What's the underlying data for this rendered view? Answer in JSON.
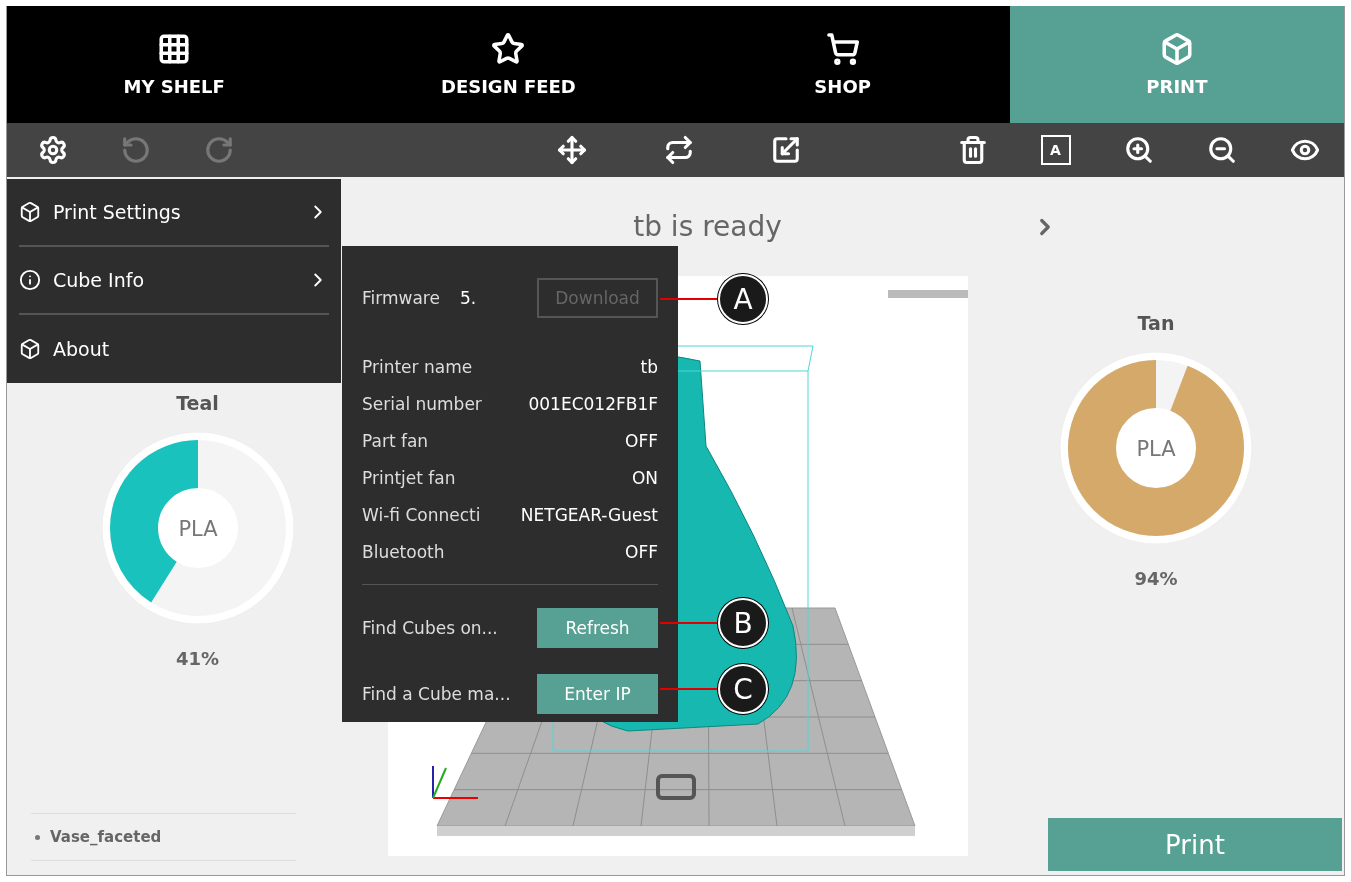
{
  "nav_tabs": [
    {
      "label": "MY SHELF",
      "selected": false
    },
    {
      "label": "DESIGN FEED",
      "selected": false
    },
    {
      "label": "SHOP",
      "selected": false
    },
    {
      "label": "PRINT",
      "selected": true
    }
  ],
  "toolbar": [
    {
      "disabled": false
    },
    {
      "disabled": true
    },
    {
      "disabled": true
    },
    {
      "disabled": false
    },
    {
      "disabled": false
    },
    {
      "disabled": false
    },
    {
      "disabled": false
    },
    {
      "disabled": false,
      "label": "A"
    },
    {
      "disabled": false
    },
    {
      "disabled": false
    },
    {
      "disabled": false
    }
  ],
  "status_title": "tb is ready",
  "materials": [
    {
      "name": "Teal",
      "type": "PLA",
      "level": 0.41,
      "reading": "41%",
      "color": "#19c2bd"
    },
    {
      "name": "Tan",
      "type": "PLA",
      "level": 0.94,
      "reading": "94%",
      "color": "#d4a96a"
    }
  ],
  "models": [
    {
      "name": "Vase_faceted"
    }
  ],
  "print_button": "Print",
  "menu": [
    {
      "label": "Print Settings",
      "has_submenu": true
    },
    {
      "label": "Cube Info",
      "has_submenu": true
    },
    {
      "label": "About",
      "has_submenu": false
    }
  ],
  "cube_info": {
    "firmware": {
      "label": "Firmware",
      "value": "5.",
      "button": "Download",
      "button_disabled": true
    },
    "details": [
      {
        "label": "Printer name",
        "value": "tb"
      },
      {
        "label": "Serial number",
        "value": "001EC012FB1F"
      },
      {
        "label": "Part fan",
        "value": "OFF"
      },
      {
        "label": "Printjet fan",
        "value": "ON"
      },
      {
        "label": "Wi-fi Connecti",
        "value": "NETGEAR-Guest"
      },
      {
        "label": "Bluetooth",
        "value": "OFF"
      }
    ],
    "actions": [
      {
        "label": "Find Cubes on...",
        "button": "Refresh"
      },
      {
        "label": "Find a Cube ma...",
        "button": "Enter IP"
      }
    ]
  },
  "callouts": [
    {
      "letter": "A"
    },
    {
      "letter": "B"
    },
    {
      "letter": "C"
    }
  ]
}
